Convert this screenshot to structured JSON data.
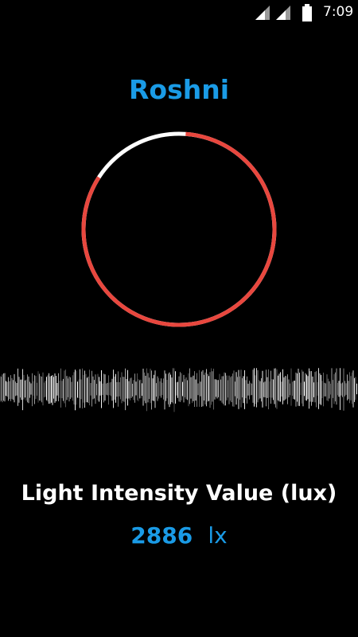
{
  "status_bar": {
    "time": "7:09",
    "icons": [
      "signal-icon",
      "signal-icon",
      "battery-icon"
    ]
  },
  "app": {
    "title": "Roshni"
  },
  "meter": {
    "level_fraction": 0.83,
    "active_color": "#e8473e",
    "track_color": "#ffffff"
  },
  "sensor": {
    "label": "Light Intensity Value (lux)",
    "value": "2886",
    "unit": "lx"
  },
  "colors": {
    "background": "#000000",
    "accent": "#1a9be6",
    "text": "#ffffff"
  }
}
